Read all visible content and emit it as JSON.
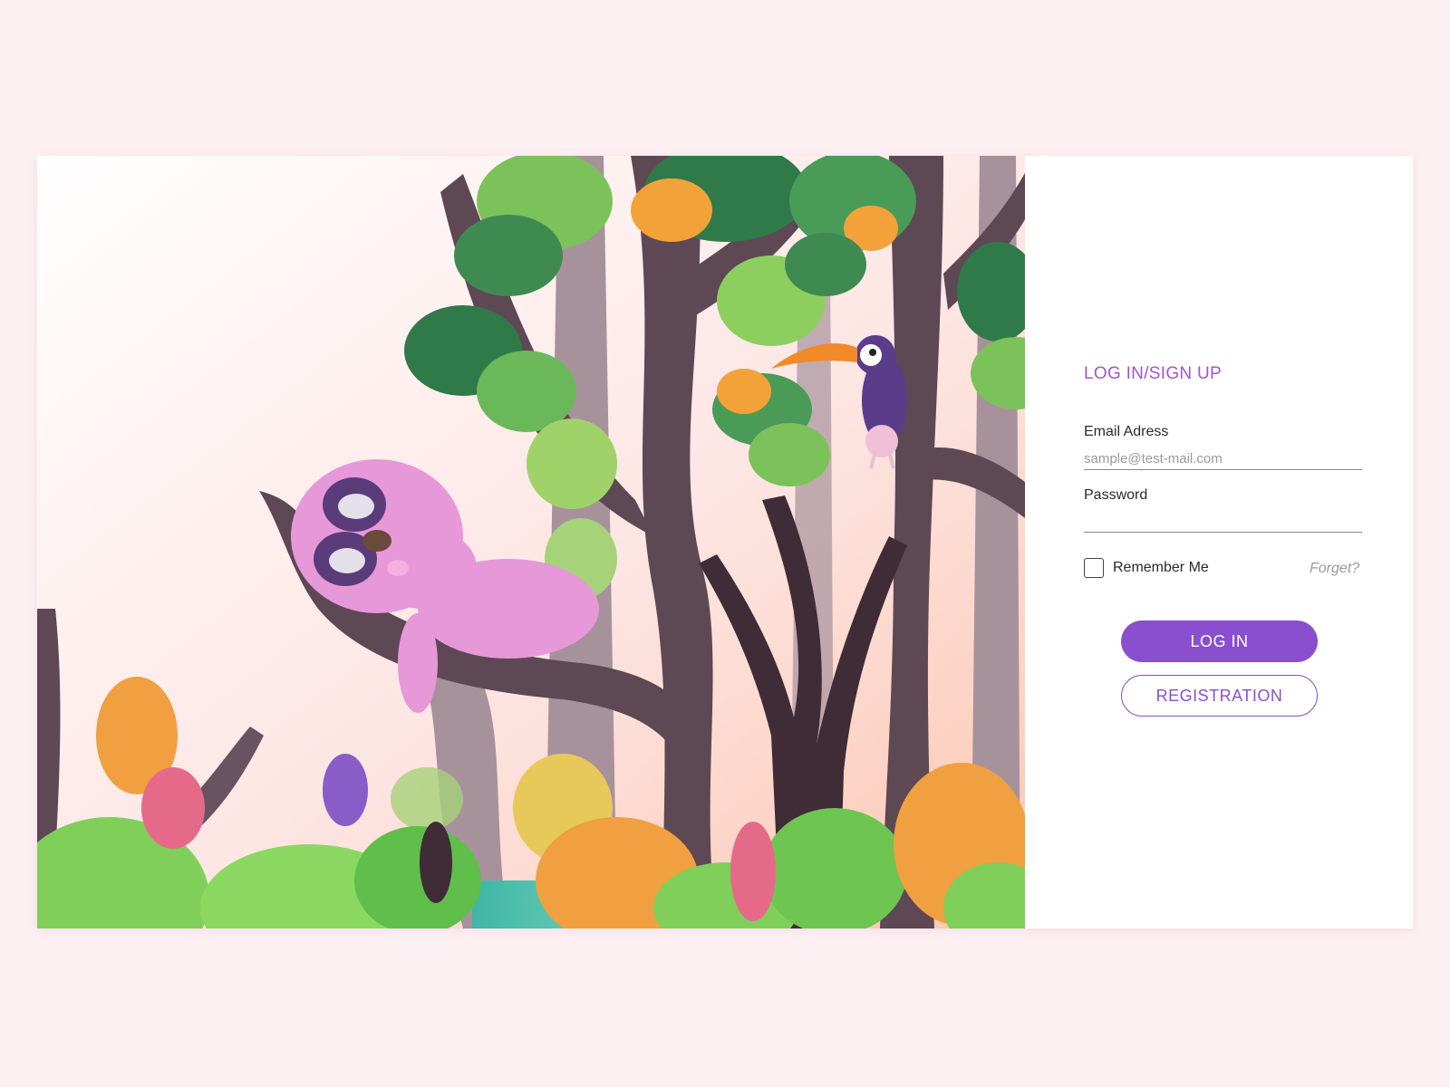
{
  "illustration": {
    "subjects": [
      "sloth",
      "toucan",
      "trees",
      "monstera-leaves",
      "jungle-plants"
    ]
  },
  "form": {
    "title": "LOG IN/SIGN UP",
    "email_label": "Email Adress",
    "email_placeholder": "sample@test-mail.com",
    "email_value": "",
    "password_label": "Password",
    "password_value": "",
    "remember_label": "Remember Me",
    "remember_checked": false,
    "forget_label": "Forget?",
    "login_label": "LOG IN",
    "register_label": "REGISTRATION"
  },
  "colors": {
    "accent": "#8a4fcf",
    "page_background": "#fdf0f3",
    "title": "#9b59c9"
  }
}
